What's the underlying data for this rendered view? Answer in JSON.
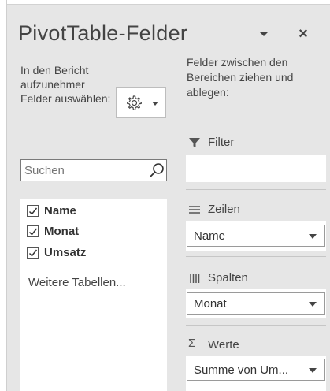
{
  "pane": {
    "title": "PivotTable-Felder",
    "close_label": "×"
  },
  "left": {
    "description": "In den Bericht aufzunehmer Felder auswählen:",
    "search_placeholder": "Suchen",
    "fields": [
      {
        "label": "Name",
        "checked": true
      },
      {
        "label": "Monat",
        "checked": true
      },
      {
        "label": "Umsatz",
        "checked": true
      }
    ],
    "more_tables": "Weitere Tabellen..."
  },
  "right": {
    "description": "Felder zwischen den Bereichen ziehen und ablegen:",
    "areas": {
      "filter": {
        "label": "Filter",
        "icon": "filter-icon"
      },
      "rows": {
        "label": "Zeilen",
        "icon": "rows-icon",
        "field": "Name"
      },
      "columns": {
        "label": "Spalten",
        "icon": "columns-icon",
        "field": "Monat"
      },
      "values": {
        "label": "Werte",
        "icon": "sigma-icon",
        "glyph": "Σ",
        "field": "Summe von Um..."
      }
    }
  },
  "colors": {
    "pane_bg": "#e6e6e6",
    "text": "#444444",
    "zone_bg": "#ffffff"
  }
}
